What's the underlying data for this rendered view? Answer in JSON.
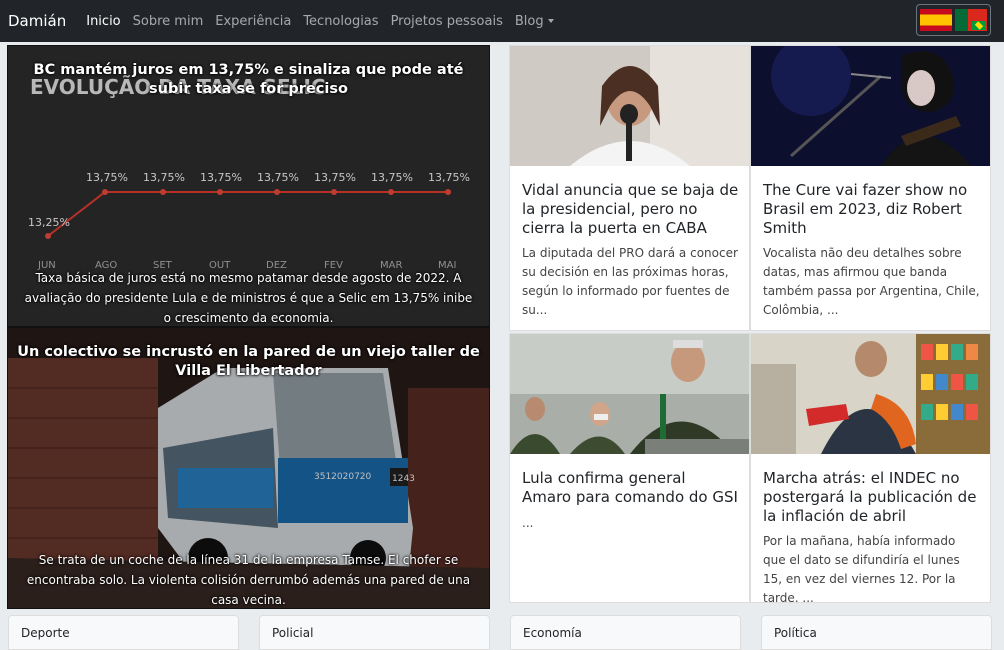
{
  "navbar": {
    "brand": "Damián",
    "links": [
      "Inicio",
      "Sobre mim",
      "Experiência",
      "Tecnologias",
      "Projetos pessoais",
      "Blog"
    ]
  },
  "languages": [
    "es",
    "pt"
  ],
  "hero": [
    {
      "title": "BC mantém juros em 13,75% e sinaliza que pode até subir taxa se for preciso",
      "desc": "Taxa básica de juros está no mesmo patamar desde agosto de 2022. A avaliação do presidente Lula e de ministros é que a Selic em 13,75% inibe o crescimento da economia.",
      "image_text": {
        "heading": "EVOLUÇÃO DA TAXA SELIC",
        "values": [
          "13,25%",
          "13,75%",
          "13,75%",
          "13,75%",
          "13,75%",
          "13,75%",
          "13,75%",
          "13,75%"
        ],
        "months": [
          "JUN",
          "AGO",
          "SET",
          "OUT",
          "DEZ",
          "FEV",
          "MAR",
          "MAI"
        ]
      }
    },
    {
      "title": "Un colectivo se incrustó en la pared de un viejo taller de Villa El Libertador",
      "desc": "Se trata de un coche de la línea 31 de la empresa Tamse. El chofer se encontraba solo. La violenta colisión derrumbó además una pared de una casa vecina.",
      "image_text": {
        "bus_number": "1243",
        "phone": "3512020720"
      }
    }
  ],
  "cards": [
    {
      "title": "Vidal anuncia que se baja de la presidencial, pero no cierra la puerta en CABA",
      "desc": "La diputada del PRO dará a conocer su decisión en las próximas horas, según lo informado por fuentes de su..."
    },
    {
      "title": "The Cure vai fazer show no Brasil em 2023, diz Robert Smith",
      "desc": "Vocalista não deu detalhes sobre datas, mas afirmou que banda também passa por Argentina, Chile, Colômbia, ..."
    },
    {
      "title": "Lula confirma general Amaro para comando do GSI",
      "desc": "..."
    },
    {
      "title": "Marcha atrás: el INDEC no postergará la publicación de la inflación de abril",
      "desc": "Por la mañana, había informado que el dato se difundiría el lunes 15, en vez del viernes 12. Por la tarde, ..."
    }
  ],
  "categories": [
    "Deporte",
    "Policial",
    "Economía",
    "Política"
  ]
}
